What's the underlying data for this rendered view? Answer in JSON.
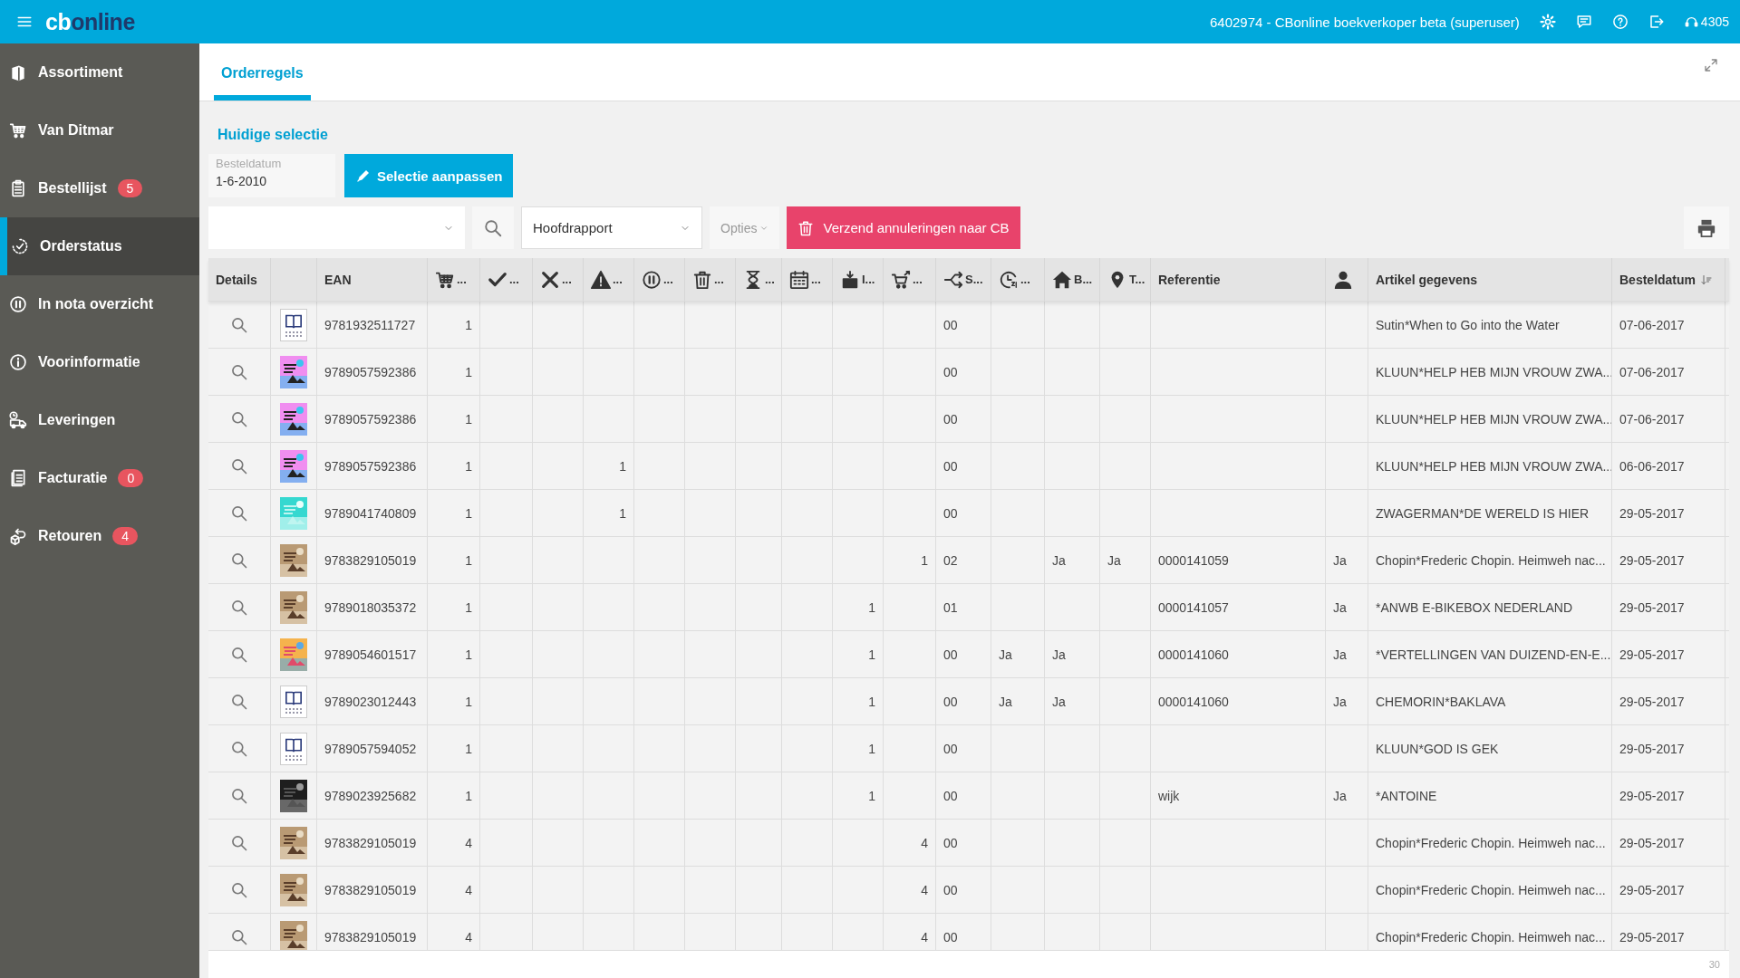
{
  "topbar": {
    "logo_bold": "cb",
    "logo_rest": "online",
    "account": "6402974 - CBonline boekverkoper beta (superuser)",
    "support_number": "4305"
  },
  "sidebar": {
    "items": [
      {
        "kind": "books",
        "label": "Assortiment",
        "selected": false
      },
      {
        "kind": "cart",
        "label": "Van Ditmar",
        "selected": false
      },
      {
        "kind": "clipboard",
        "label": "Bestellijst",
        "badge": "5",
        "selected": false
      },
      {
        "kind": "status",
        "label": "Orderstatus",
        "selected": true
      },
      {
        "kind": "pause",
        "label": "In nota overzicht",
        "selected": false
      },
      {
        "kind": "info",
        "label": "Voorinformatie",
        "selected": false
      },
      {
        "kind": "truck",
        "label": "Leveringen",
        "selected": false
      },
      {
        "kind": "invoice",
        "label": "Facturatie",
        "badge": "0",
        "selected": false
      },
      {
        "kind": "return",
        "label": "Retouren",
        "badge": "4",
        "selected": false
      }
    ]
  },
  "tabs": [
    {
      "label": "Orderregels",
      "selected": true
    }
  ],
  "selection": {
    "title": "Huidige selectie",
    "date_label": "Besteldatum",
    "date_value": "1-6-2010",
    "edit_button": "Selectie aanpassen"
  },
  "toolbar": {
    "report_select": "Hoofdrapport",
    "options": "Opties",
    "cancel_button": "Verzend annuleringen naar CB"
  },
  "table": {
    "columns": [
      {
        "kind": "text",
        "label": "Details"
      },
      {
        "kind": "blank"
      },
      {
        "kind": "text",
        "label": "EAN"
      },
      {
        "kind": "cart",
        "label": "..."
      },
      {
        "kind": "check",
        "label": "..."
      },
      {
        "kind": "cross",
        "label": "..."
      },
      {
        "kind": "warning",
        "label": "..."
      },
      {
        "kind": "pause",
        "label": "..."
      },
      {
        "kind": "trash",
        "label": "..."
      },
      {
        "kind": "hourglass",
        "label": "..."
      },
      {
        "kind": "calendar",
        "label": "..."
      },
      {
        "kind": "box",
        "label": "I..."
      },
      {
        "kind": "cart-out",
        "label": "..."
      },
      {
        "kind": "split",
        "label": "S..."
      },
      {
        "kind": "clock",
        "label": "..."
      },
      {
        "kind": "home",
        "label": "B..."
      },
      {
        "kind": "pin",
        "label": "T..."
      },
      {
        "kind": "text",
        "label": "Referentie"
      },
      {
        "kind": "person"
      },
      {
        "kind": "text",
        "label": "Artikel gegevens"
      },
      {
        "kind": "text",
        "label": "Besteldatum",
        "sorted": true
      }
    ],
    "rows": [
      {
        "thumbnail": {
          "kind": "placeholder"
        },
        "cells": [
          "",
          "",
          "9781932511727",
          "1",
          "",
          "",
          "",
          "",
          "",
          "",
          "",
          "",
          "",
          "00",
          "",
          "",
          "",
          "",
          "",
          "Sutin*When to Go into the Water",
          "07-06-2017"
        ]
      },
      {
        "thumbnail": {
          "kind": "pink"
        },
        "cells": [
          "",
          "",
          "9789057592386",
          "1",
          "",
          "",
          "",
          "",
          "",
          "",
          "",
          "",
          "",
          "00",
          "",
          "",
          "",
          "",
          "",
          "KLUUN*HELP HEB MIJN VROUW ZWA...",
          "07-06-2017"
        ]
      },
      {
        "thumbnail": {
          "kind": "pink"
        },
        "cells": [
          "",
          "",
          "9789057592386",
          "1",
          "",
          "",
          "",
          "",
          "",
          "",
          "",
          "",
          "",
          "00",
          "",
          "",
          "",
          "",
          "",
          "KLUUN*HELP HEB MIJN VROUW ZWA...",
          "07-06-2017"
        ]
      },
      {
        "thumbnail": {
          "kind": "pink"
        },
        "cells": [
          "",
          "",
          "9789057592386",
          "1",
          "",
          "",
          "1",
          "",
          "",
          "",
          "",
          "",
          "",
          "00",
          "",
          "",
          "",
          "",
          "",
          "KLUUN*HELP HEB MIJN VROUW ZWA...",
          "06-06-2017"
        ]
      },
      {
        "thumbnail": {
          "kind": "teal"
        },
        "cells": [
          "",
          "",
          "9789041740809",
          "1",
          "",
          "",
          "1",
          "",
          "",
          "",
          "",
          "",
          "",
          "00",
          "",
          "",
          "",
          "",
          "",
          "ZWAGERMAN*DE WERELD IS HIER",
          "29-05-2017"
        ]
      },
      {
        "cells": [
          "",
          "",
          "9783829105019",
          "1",
          "",
          "",
          "",
          "",
          "",
          "",
          "",
          "",
          "1",
          "02",
          "",
          "Ja",
          "Ja",
          "0000141059",
          "Ja",
          "Chopin*Frederic Chopin. Heimweh nac...",
          "29-05-2017"
        ]
      },
      {
        "cells": [
          "",
          "",
          "9789018035372",
          "1",
          "",
          "",
          "",
          "",
          "",
          "",
          "",
          "1",
          "",
          "01",
          "",
          "",
          "",
          "0000141057",
          "Ja",
          "*ANWB E-BIKEBOX NEDERLAND",
          "29-05-2017"
        ]
      },
      {
        "thumbnail": {
          "kind": "colorful"
        },
        "cells": [
          "",
          "",
          "9789054601517",
          "1",
          "",
          "",
          "",
          "",
          "",
          "",
          "",
          "1",
          "",
          "00",
          "Ja",
          "Ja",
          "",
          "0000141060",
          "Ja",
          "*VERTELLINGEN VAN DUIZEND-EN-E...",
          "29-05-2017"
        ]
      },
      {
        "thumbnail": {
          "kind": "placeholder"
        },
        "cells": [
          "",
          "",
          "9789023012443",
          "1",
          "",
          "",
          "",
          "",
          "",
          "",
          "",
          "1",
          "",
          "00",
          "Ja",
          "Ja",
          "",
          "0000141060",
          "Ja",
          "CHEMORIN*BAKLAVA",
          "29-05-2017"
        ]
      },
      {
        "thumbnail": {
          "kind": "placeholder"
        },
        "cells": [
          "",
          "",
          "9789057594052",
          "1",
          "",
          "",
          "",
          "",
          "",
          "",
          "",
          "1",
          "",
          "00",
          "",
          "",
          "",
          "",
          "",
          "KLUUN*GOD IS GEK",
          "29-05-2017"
        ]
      },
      {
        "thumbnail": {
          "kind": "dark"
        },
        "cells": [
          "",
          "",
          "9789023925682",
          "1",
          "",
          "",
          "",
          "",
          "",
          "",
          "",
          "1",
          "",
          "00",
          "",
          "",
          "",
          "wijk",
          "Ja",
          "*ANTOINE",
          "29-05-2017"
        ]
      },
      {
        "cells": [
          "",
          "",
          "9783829105019",
          "4",
          "",
          "",
          "",
          "",
          "",
          "",
          "",
          "",
          "4",
          "00",
          "",
          "",
          "",
          "",
          "",
          "Chopin*Frederic Chopin. Heimweh nac...",
          "29-05-2017"
        ]
      },
      {
        "cells": [
          "",
          "",
          "9783829105019",
          "4",
          "",
          "",
          "",
          "",
          "",
          "",
          "",
          "",
          "4",
          "00",
          "",
          "",
          "",
          "",
          "",
          "Chopin*Frederic Chopin. Heimweh nac...",
          "29-05-2017"
        ]
      },
      {
        "cells": [
          "",
          "",
          "9783829105019",
          "4",
          "",
          "",
          "",
          "",
          "",
          "",
          "",
          "",
          "4",
          "00",
          "",
          "",
          "",
          "",
          "",
          "Chopin*Frederic Chopin. Heimweh nac...",
          "29-05-2017"
        ]
      }
    ],
    "footer_count": "30"
  }
}
